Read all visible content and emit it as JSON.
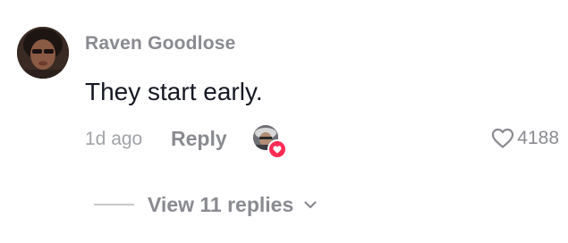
{
  "comment": {
    "author": "Raven Goodlose",
    "text": "They start early.",
    "timestamp": "1d ago",
    "reply_label": "Reply",
    "like_count": "4188",
    "liked_by_creator": true,
    "view_replies_label": "View 11 replies"
  },
  "icons": {
    "like": "heart-outline-icon",
    "creator_like_badge": "heart-filled-icon",
    "expand": "chevron-down-icon"
  },
  "colors": {
    "heart_badge": "#fe2c55",
    "username": "#8a8b91",
    "comment_text": "#161823"
  }
}
